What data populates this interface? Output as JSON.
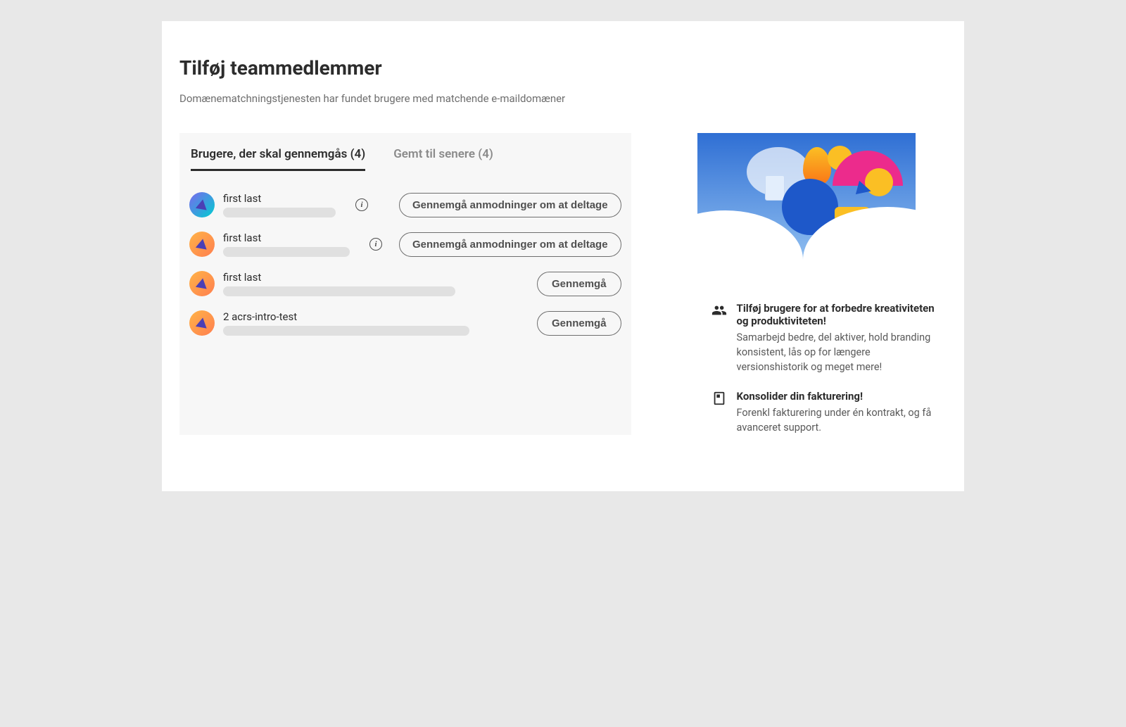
{
  "header": {
    "title": "Tilføj teammedlemmer",
    "subtitle": "Domænematchningstjenesten har fundet brugere med matchende e-maildomæner"
  },
  "tabs": {
    "review": {
      "label": "Brugere, der skal gennemgås",
      "count": 4
    },
    "saved": {
      "label": "Gemt til senere",
      "count": 4
    }
  },
  "actions": {
    "review_request": "Gennemgå anmodninger om at deltage",
    "review": "Gennemgå"
  },
  "users": [
    {
      "name": "first last",
      "avatar_style": "cool",
      "has_info": true,
      "action": "review_request",
      "placeholder_width": 160
    },
    {
      "name": "first last",
      "avatar_style": "warm",
      "has_info": true,
      "action": "review_request",
      "placeholder_width": 180
    },
    {
      "name": "first last",
      "avatar_style": "warm",
      "has_info": false,
      "action": "review",
      "placeholder_width": 330
    },
    {
      "name": "2 acrs-intro-test",
      "avatar_style": "warm",
      "has_info": false,
      "action": "review",
      "placeholder_width": 350
    }
  ],
  "benefits": [
    {
      "icon": "users-icon",
      "title": "Tilføj brugere for at forbedre kreativiteten og produktiviteten!",
      "desc": "Samarbejd bedre, del aktiver, hold branding konsistent, lås op for længere versionshistorik og meget mere!"
    },
    {
      "icon": "document-icon",
      "title": "Konsolider din fakturering!",
      "desc": "Forenkl fakturering under én kontrakt, og få avanceret support."
    }
  ]
}
